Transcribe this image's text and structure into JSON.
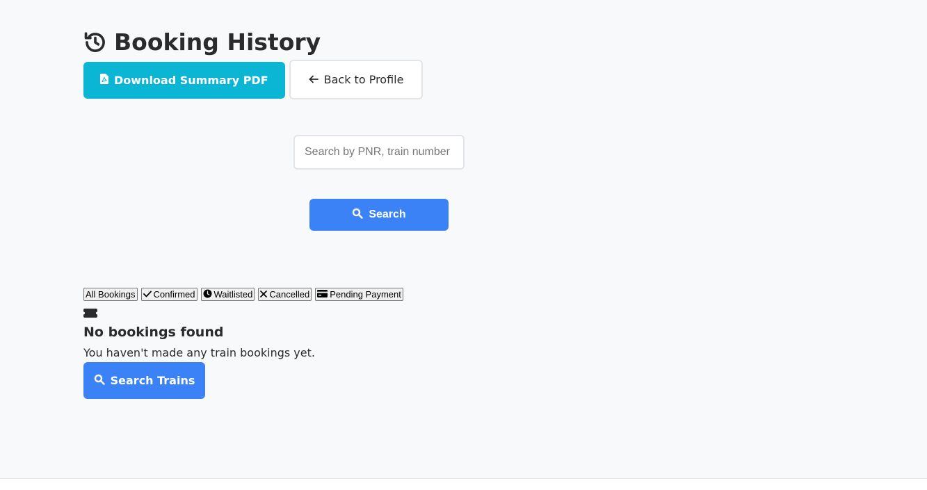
{
  "header": {
    "title": "Booking History",
    "title_icon": "history-icon"
  },
  "actions": {
    "download_label": "Download Summary PDF",
    "download_icon": "pdf-file-icon",
    "back_label": "Back to Profile",
    "back_icon": "arrow-left-icon"
  },
  "search": {
    "placeholder": "Search by PNR, train number",
    "value": "",
    "button_label": "Search",
    "button_icon": "search-icon"
  },
  "filters": [
    {
      "label": "All Bookings",
      "icon": ""
    },
    {
      "label": "Confirmed",
      "icon": "check-icon"
    },
    {
      "label": "Waitlisted",
      "icon": "clock-icon"
    },
    {
      "label": "Cancelled",
      "icon": "x-icon"
    },
    {
      "label": "Pending Payment",
      "icon": "credit-card-icon"
    }
  ],
  "empty_state": {
    "icon": "ticket-icon",
    "title": "No bookings found",
    "message": "You haven't made any train bookings yet.",
    "button_label": "Search Trains",
    "button_icon": "search-icon"
  },
  "colors": {
    "background": "#f8f9fb",
    "info": "#0bb6d4",
    "primary": "#3b82f6",
    "text": "#2b2b2b"
  }
}
